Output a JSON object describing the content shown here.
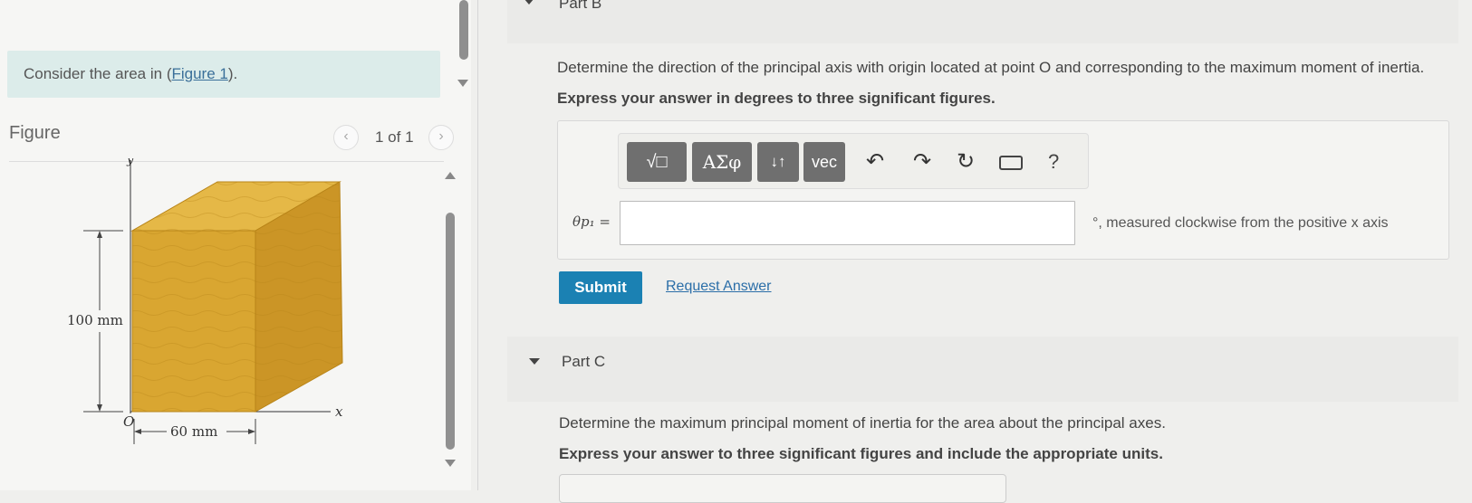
{
  "intro": {
    "prefix": "Consider the area in (",
    "link": "Figure 1",
    "suffix": ")."
  },
  "figure": {
    "heading": "Figure",
    "counter": "1 of 1",
    "prev_icon": "‹",
    "next_icon": "›",
    "labels": {
      "height": "100 mm",
      "width": "60 mm",
      "origin": "O",
      "x_axis": "x",
      "y_axis": "y"
    }
  },
  "part_b": {
    "title": "Part B",
    "question": "Determine the direction of the principal axis with origin located at point O and corresponding to the maximum moment of inertia.",
    "instruction": "Express your answer in degrees to three significant figures.",
    "toolbar": {
      "templates": "√□",
      "greek": "ΑΣφ",
      "arrows": "↓↑",
      "vector": "vec",
      "help": "?"
    },
    "variable_label": "θp₁ =",
    "input_value": "",
    "unit_text": "°, measured clockwise from the positive x axis",
    "submit_label": "Submit",
    "request_label": "Request Answer"
  },
  "part_c": {
    "title": "Part C",
    "question": "Determine the maximum principal moment of inertia for the area about the principal axes.",
    "instruction": "Express your answer to three significant figures and include the appropriate units."
  },
  "colors": {
    "intro_bg": "#dcecea",
    "submit_bg": "#1b81b3",
    "link": "#2b6ea8",
    "wood_front": "#d9a631",
    "wood_top": "#e5b847",
    "wood_side": "#cb9526"
  }
}
